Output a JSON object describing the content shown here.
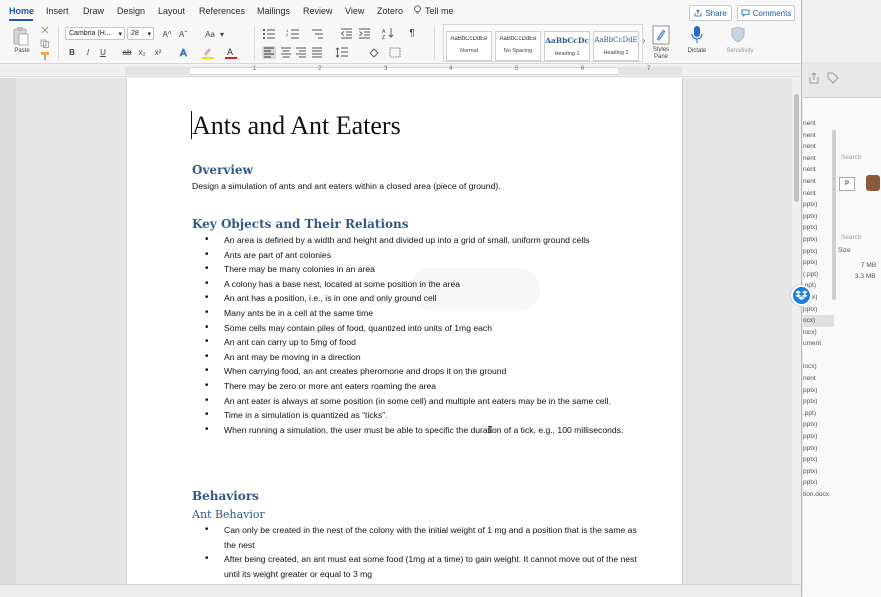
{
  "menu": {
    "tabs": [
      "Home",
      "Insert",
      "Draw",
      "Design",
      "Layout",
      "References",
      "Mailings",
      "Review",
      "View",
      "Zotero",
      "Tell me"
    ],
    "share_label": "Share",
    "comments_label": "Comments"
  },
  "ribbon": {
    "paste_label": "Paste",
    "font_name": "Cambria (H...",
    "font_size": "28",
    "grow_font": "A^",
    "shrink_font": "Aˇ",
    "change_case": "Aa",
    "bold": "B",
    "italic": "I",
    "underline": "U",
    "strike": "ab",
    "subscript": "x₂",
    "superscript": "x²",
    "styles": [
      {
        "sample": "AaBbCcDdEe",
        "name": "Normal"
      },
      {
        "sample": "AaBbCcDdEe",
        "name": "No Spacing"
      },
      {
        "sample": "AaBbCcDc",
        "name": "Heading 1"
      },
      {
        "sample": "AaBbCcDdE",
        "name": "Heading 2"
      }
    ],
    "styles_pane_label": "Styles\nPane",
    "dictate_label": "Dictate",
    "sensitivity_label": "Sensitivity"
  },
  "ruler": {
    "numbers": [
      "1",
      "2",
      "3",
      "4",
      "5",
      "6",
      "7"
    ]
  },
  "document": {
    "title": "Ants and Ant Eaters",
    "overview_heading": "Overview",
    "overview_text": "Design a simulation of ants and ant eaters within a closed area (piece of ground).",
    "key_objects_heading": "Key Objects and Their Relations",
    "key_objects": [
      "An area is defined by a width and height and divided up into a grid of small, uniform ground cells",
      "Ants are part of ant colonies",
      "There may be many colonies in an area",
      "A colony has a base nest, located at some position in the area",
      "An ant has a position, i.e., is in one and only ground cell",
      "Many ants be in a cell at the same time",
      "Some cells may contain piles of food, quantized into units of 1mg each",
      "An ant can carry up to 5mg of food",
      "An ant may be moving in a direction",
      "When carrying food, an ant creates pheromone and drops it on the ground",
      "There may be zero or more ant eaters roaming the area",
      "An ant eater is always at some position (in some cell) and multiple ant eaters may be in the same cell.",
      "Time in a simulation is quantized as “ticks”.",
      "When running a simulation, the user must be able to specific the duration of a tick, e.g., 100 milliseconds."
    ],
    "behaviors_heading": "Behaviors",
    "ant_behavior_heading": "Ant Behavior",
    "ant_behaviors": [
      "Can only be created in the nest of the colony with the initial weight of 1 mg and a position that is the same as the nest",
      "After being created, an ant must eat some food (1mg at a time) to gain weight.  It cannot move out of the nest until its weight greater or equal to 3 mg"
    ]
  },
  "finder": {
    "search_label": "Search",
    "size_header": "Size",
    "sizes": [
      "7 MB",
      "3.3 MB"
    ],
    "thumb_label": "P",
    "files": [
      "nent",
      "nent",
      "nent",
      "nent",
      "nent",
      "nent",
      "nent",
      "pptx)",
      "pptx)",
      "pptx)",
      "pptx)",
      "pptx)",
      "pptx)",
      "(.ppt)",
      ".ppt)",
      "pptx)",
      "pptx)",
      "ocx)",
      "locx)",
      "ument",
      "",
      "locx)",
      "nent",
      "pptx)",
      "pptx)",
      ".ppt)",
      "pptx)",
      "pptx)",
      "pptx)",
      "pptx)",
      "pptx)",
      "pptx)",
      "tion.docx"
    ]
  }
}
